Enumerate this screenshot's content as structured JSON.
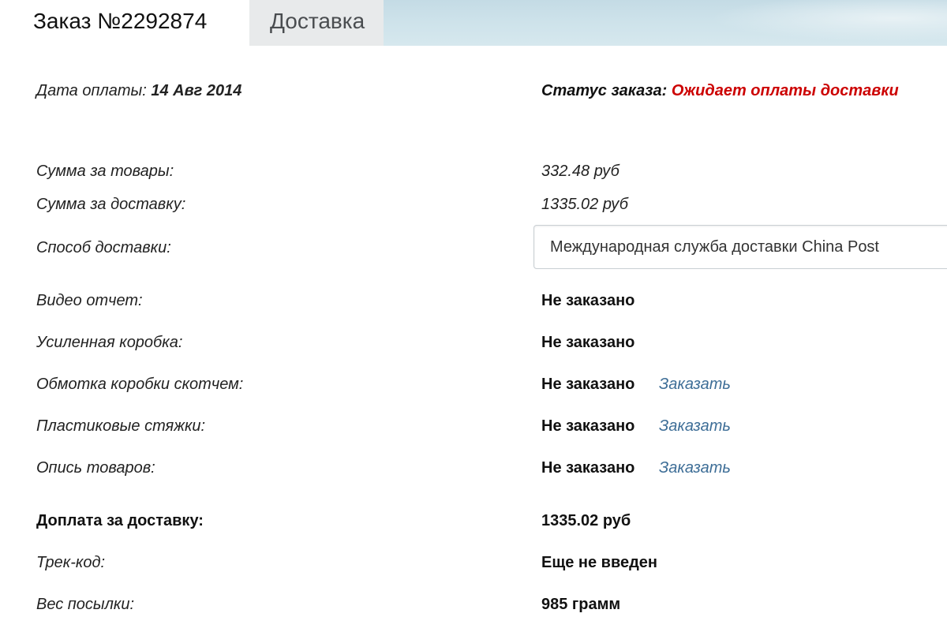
{
  "tabs": [
    {
      "label": "Заказ №2292874",
      "active": true
    },
    {
      "label": "Доставка",
      "active": false
    }
  ],
  "header": {
    "pay_date_label": "Дата оплаты:",
    "pay_date_value": "14 Авг 2014",
    "status_label": "Статус заказа:",
    "status_value": "Ожидает оплаты доставки"
  },
  "summary": {
    "goods_sum_label": "Сумма за товары:",
    "goods_sum_value": "332.48 руб",
    "delivery_sum_label": "Сумма за доставку:",
    "delivery_sum_value": "1335.02 руб",
    "delivery_method_label": "Способ доставки:",
    "delivery_method_value": "Международная служба доставки China Post"
  },
  "options": [
    {
      "label": "Видео отчет:",
      "value": "Не заказано",
      "link": ""
    },
    {
      "label": "Усиленная коробка:",
      "value": "Не заказано",
      "link": ""
    },
    {
      "label": "Обмотка коробки скотчем:",
      "value": "Не заказано",
      "link": "Заказать"
    },
    {
      "label": "Пластиковые стяжки:",
      "value": "Не заказано",
      "link": "Заказать"
    },
    {
      "label": "Опись товаров:",
      "value": "Не заказано",
      "link": "Заказать"
    }
  ],
  "totals": {
    "surcharge_label": "Доплата за доставку:",
    "surcharge_value": "1335.02 руб",
    "track_label": "Трек-код:",
    "track_value": "Еще не введен",
    "weight_label": "Вес посылки:",
    "weight_value": "985 грамм"
  },
  "colors": {
    "status": "#cc0000",
    "link": "#3e6e97"
  }
}
